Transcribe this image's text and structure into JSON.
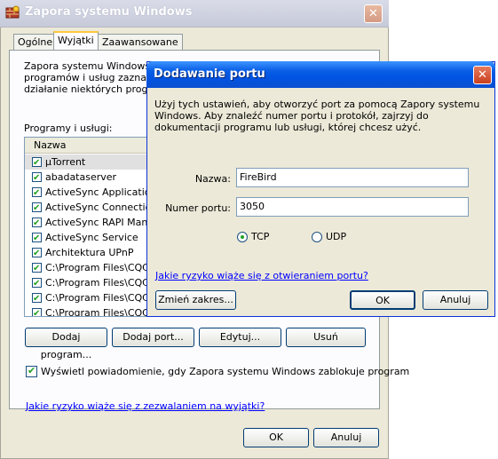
{
  "background_window": {
    "title": "Zapora systemu Windows",
    "tabs": [
      {
        "label": "Ogólne",
        "active": false
      },
      {
        "label": "Wyjątki",
        "active": true
      },
      {
        "label": "Zaawansowane",
        "active": false
      }
    ],
    "description_lines": [
      "Zapora systemu Windows blo",
      "programów i usług zaznaczo",
      "działanie niektórych program"
    ],
    "programs_label": "Programy i usługi:",
    "list_header": "Nazwa",
    "list_items": [
      "µTorrent",
      "abadataserver",
      "ActiveSync Application",
      "ActiveSync Connection",
      "ActiveSync RAPI Manag",
      "ActiveSync Service",
      "Architektura UPnP",
      "C:\\Program Files\\CQC\\E",
      "C:\\Program Files\\CQC\\E",
      "C:\\Program Files\\CQC\\E",
      "C:\\Program Files\\CQC\\E"
    ],
    "buttons": {
      "add_program": "Dodaj program...",
      "add_port": "Dodaj port...",
      "edit": "Edytuj...",
      "delete": "Usuń"
    },
    "notify_checkbox_label": "Wyświetl powiadomienie, gdy Zapora systemu Windows zablokuje program",
    "risk_link": "Jakie ryzyko wiąże się z zezwalaniem na wyjątki?",
    "ok": "OK",
    "cancel": "Anuluj"
  },
  "dialog": {
    "title": "Dodawanie portu",
    "description": "Użyj tych ustawień, aby otworzyć port za pomocą Zapory systemu Windows. Aby znaleźć numer portu i protokół, zajrzyj do dokumentacji programu lub usługi, której chcesz użyć.",
    "name_label": "Nazwa:",
    "name_value": "FireBird",
    "port_label": "Numer portu:",
    "port_value": "3050",
    "tcp_label": "TCP",
    "udp_label": "UDP",
    "protocol_selected": "TCP",
    "risk_link": "Jakie ryzyko wiąże się z otwieraniem portu?",
    "change_scope": "Zmień zakres...",
    "ok": "OK",
    "cancel": "Anuluj"
  }
}
